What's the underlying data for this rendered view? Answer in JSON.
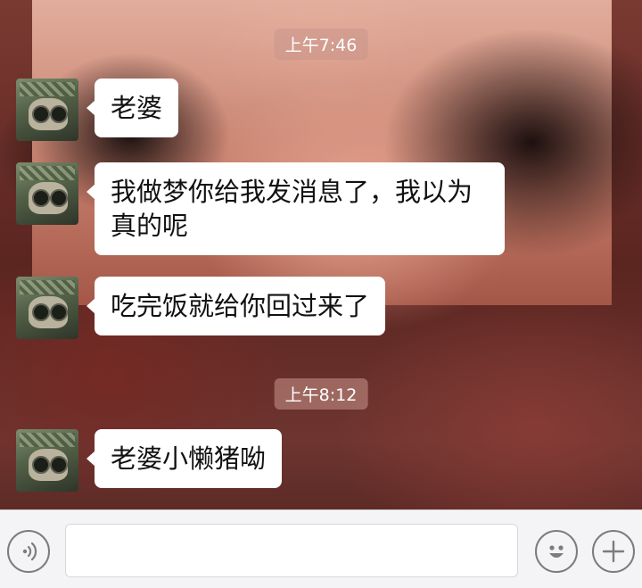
{
  "timestamps": [
    "上午7:46",
    "上午8:12"
  ],
  "messages": [
    {
      "text": "老婆"
    },
    {
      "text": "我做梦你给我发消息了，我以为真的呢"
    },
    {
      "text": "吃完饭就给你回过来了"
    },
    {
      "text": "老婆小懒猪呦"
    }
  ],
  "input_bar": {
    "text_value": "",
    "voice_icon": "voice-icon",
    "emoji_icon": "emoji-icon",
    "plus_icon": "plus-icon"
  }
}
